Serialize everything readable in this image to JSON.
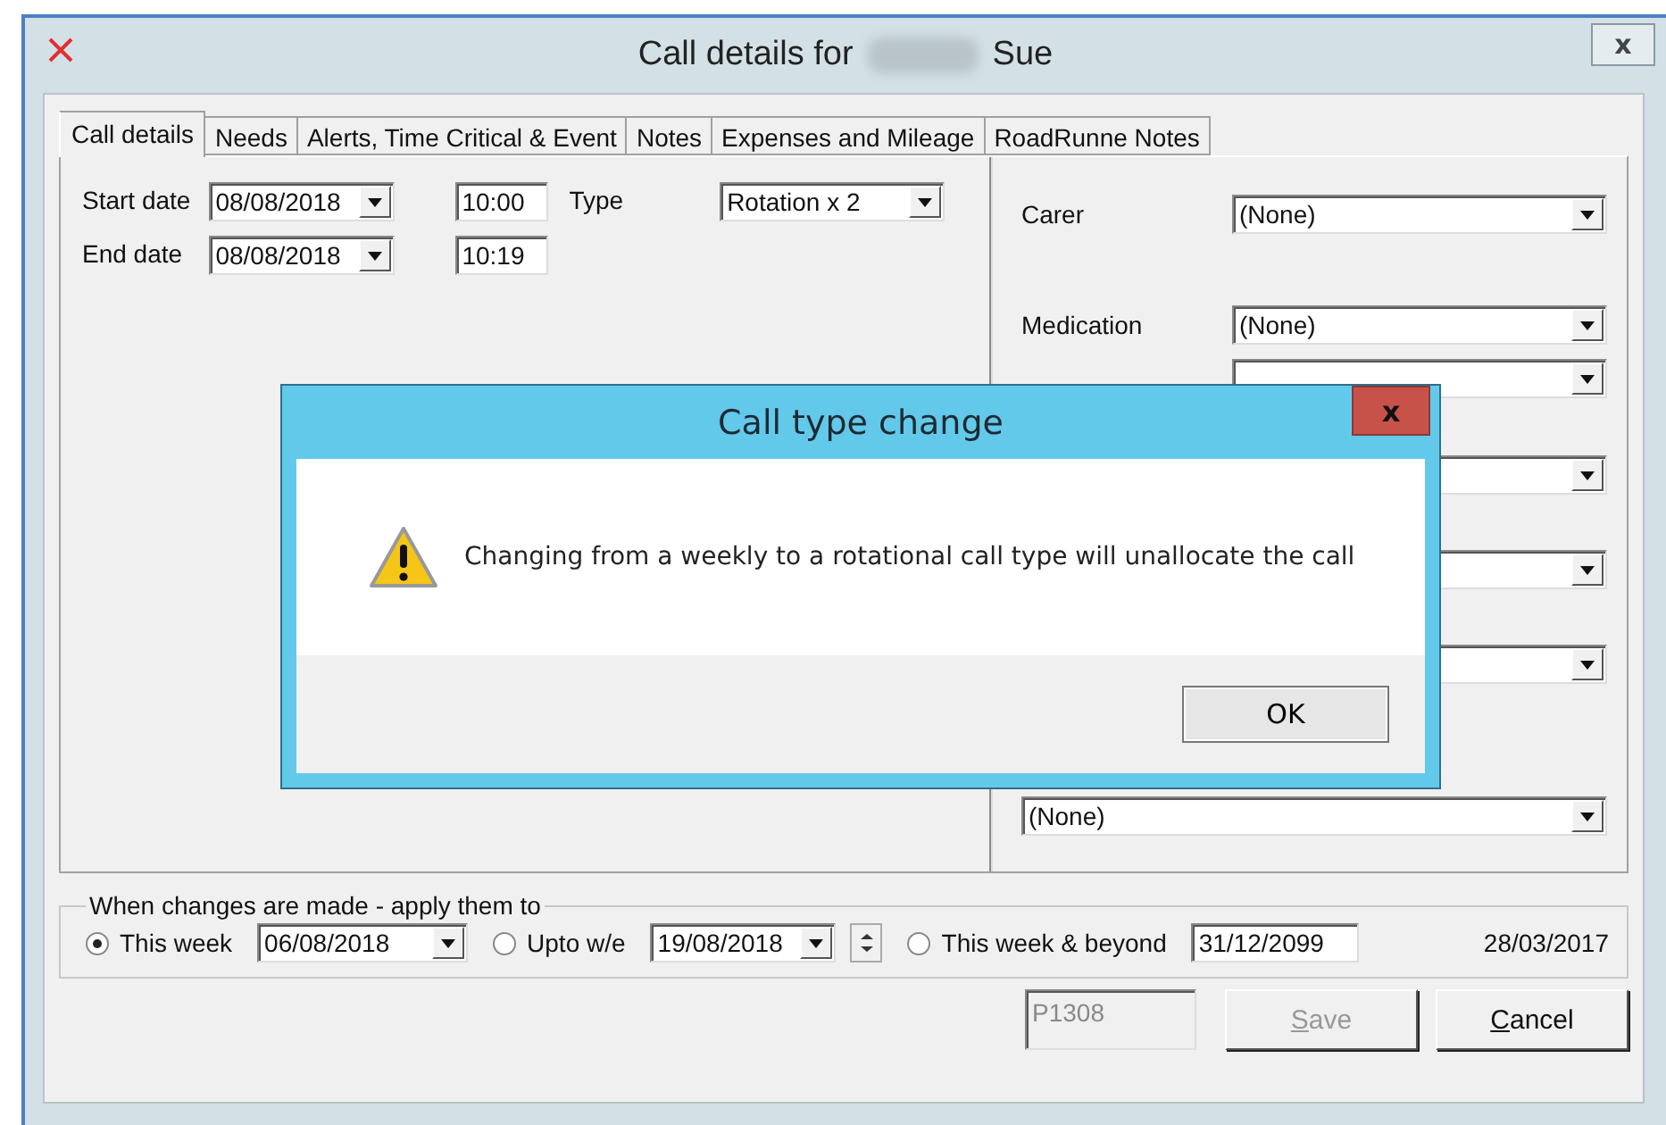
{
  "window": {
    "title": "Call details for",
    "title_name": "Sue",
    "close": "x"
  },
  "tabs": [
    {
      "label": "Call details",
      "selected": true
    },
    {
      "label": "Needs",
      "selected": false
    },
    {
      "label": "Alerts, Time Critical & Event",
      "selected": false
    },
    {
      "label": "Notes",
      "selected": false
    },
    {
      "label": "Expenses and Mileage",
      "selected": false
    },
    {
      "label": "RoadRunne Notes",
      "selected": false
    }
  ],
  "call": {
    "start_label": "Start date",
    "start_date": "08/08/2018",
    "start_time": "10:00",
    "end_label": "End date",
    "end_date": "08/08/2018",
    "end_time": "10:19",
    "type_label": "Type",
    "type_value": "Rotation x 2"
  },
  "right_panel": [
    {
      "kind": "combo",
      "label": "Carer",
      "value": "(None)"
    },
    {
      "kind": "combo",
      "label": "Medication",
      "value": "(None)"
    },
    {
      "kind": "combo"
    },
    {
      "kind": "combo"
    },
    {
      "kind": "combo"
    },
    {
      "kind": "combo"
    },
    {
      "kind": "combo",
      "value": "(None)"
    }
  ],
  "apply": {
    "legend": "When changes are made - apply them to",
    "options": [
      {
        "label": "This week",
        "selected": true,
        "value": "06/08/2018",
        "kind": "combo"
      },
      {
        "label": "Upto w/e",
        "selected": false,
        "value": "19/08/2018",
        "kind": "spin"
      },
      {
        "label": "This week & beyond",
        "selected": false,
        "value": "31/12/2099",
        "kind": "text"
      }
    ],
    "date": "28/03/2017"
  },
  "footer": {
    "code": "P1308",
    "buttons": [
      {
        "label": "Save",
        "disabled": true
      },
      {
        "label": "Cancel",
        "disabled": false
      }
    ]
  },
  "dialog": {
    "title": "Call type change",
    "message": "Changing from a weekly to a rotational call type will unallocate the call",
    "button": "OK",
    "close": "x"
  }
}
